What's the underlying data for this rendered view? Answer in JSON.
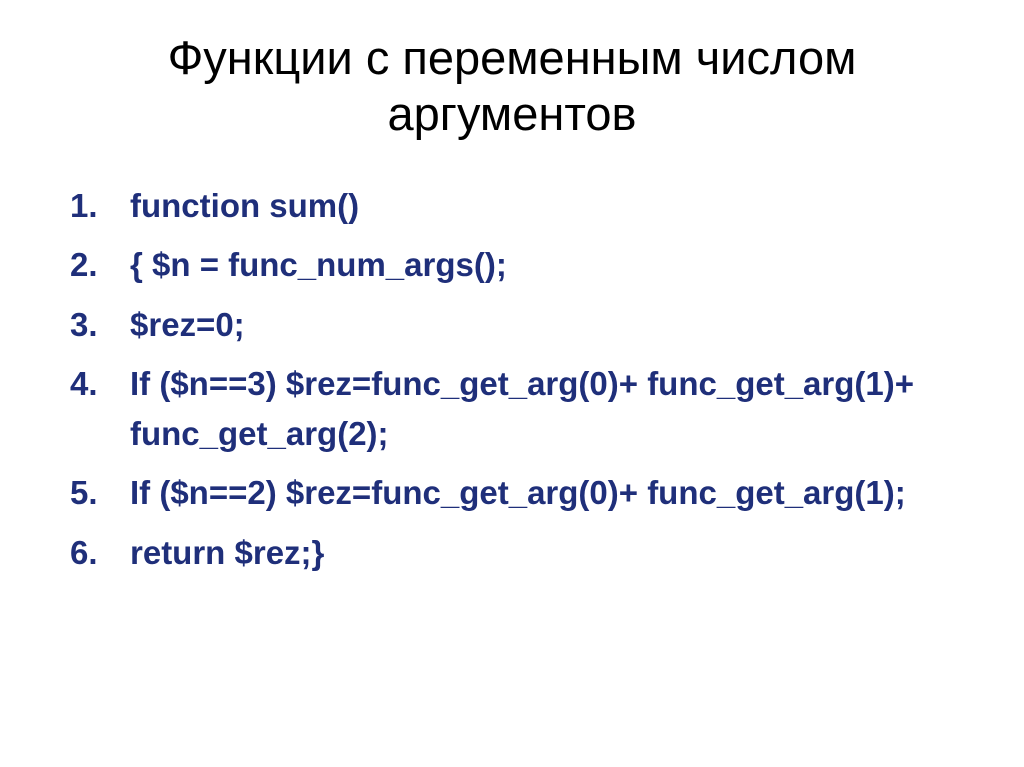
{
  "title": "Функции с переменным числом аргументов",
  "code": {
    "line1": "function sum()",
    "line2": "{ $n = func_num_args();",
    "line3": "$rez=0;",
    "line4": "If ($n==3) $rez=func_get_arg(0)+ func_get_arg(1)+ func_get_arg(2);",
    "line5": "If ($n==2) $rez=func_get_arg(0)+ func_get_arg(1);",
    "line6": "return $rez;}"
  }
}
